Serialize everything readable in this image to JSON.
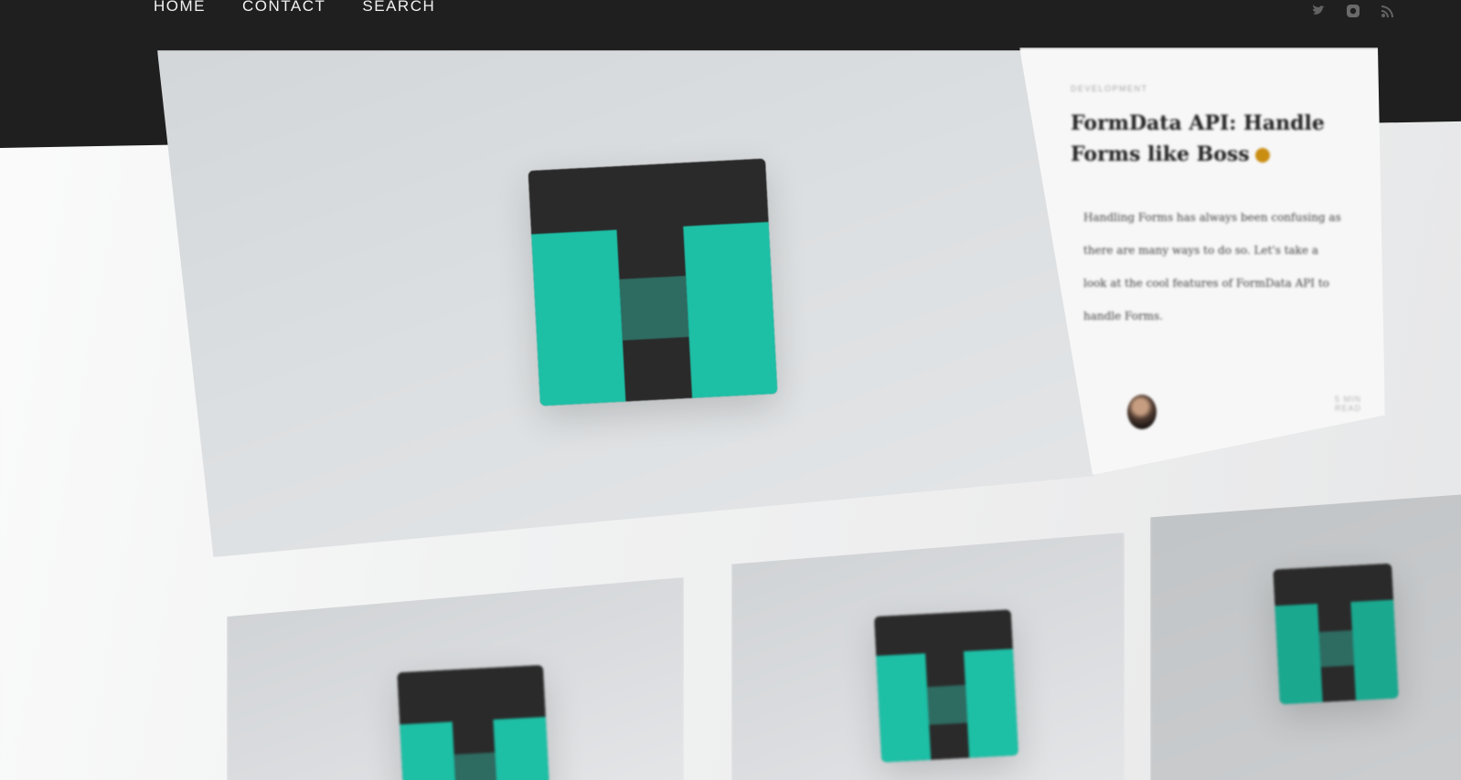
{
  "nav": {
    "links": [
      "HOME",
      "CONTACT",
      "SEARCH"
    ]
  },
  "social": [
    "twitter-icon",
    "instagram-icon",
    "rss-icon"
  ],
  "hero_post": {
    "category": "DEVELOPMENT",
    "title": "FormData API: Handle Forms like Boss",
    "excerpt": "Handling Forms has always been confusing as there are many ways to do so. Let's take a look at the cool features of FormData API to handle Forms.",
    "read_more": "5 MIN READ"
  },
  "colors": {
    "nav_bg": "#1f1f1f",
    "logo_dark": "#2a2a2a",
    "logo_teal": "#1dbfa5",
    "logo_teal_dark": "#2e6b61"
  },
  "logo_icon": "teal-t-logo"
}
